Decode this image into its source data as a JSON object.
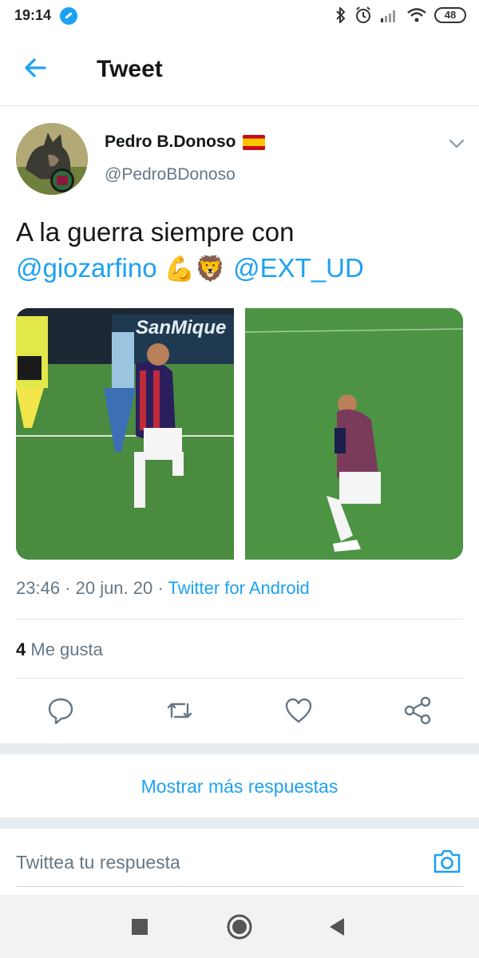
{
  "status_bar": {
    "time": "19:14",
    "battery": "48",
    "icons": [
      "bluetooth-icon",
      "alarm-icon",
      "signal-icon",
      "wifi-icon",
      "battery-icon"
    ]
  },
  "header": {
    "title": "Tweet",
    "back_icon": "arrow-left-icon"
  },
  "tweet": {
    "author_name": "Pedro B.Donoso",
    "author_flag": "spain-flag",
    "author_handle": "@PedroBDonoso",
    "text_prefix": "A la guerra siempre con",
    "mention_1": "@giozarfino",
    "emojis": "💪🦁",
    "mention_2": "@EXT_UD",
    "timestamp": "23:46 · 20 jun. 20 · ",
    "source": "Twitter for Android",
    "likes_count": "4",
    "likes_label": "Me gusta"
  },
  "actions": [
    "reply-icon",
    "retweet-icon",
    "like-icon",
    "share-icon"
  ],
  "more_replies": "Mostrar más respuestas",
  "reply": {
    "placeholder": "Twittea tu respuesta"
  },
  "colors": {
    "accent": "#1da1f2",
    "text": "#14171a",
    "secondary": "#657786",
    "divider": "#e1e8ed"
  }
}
